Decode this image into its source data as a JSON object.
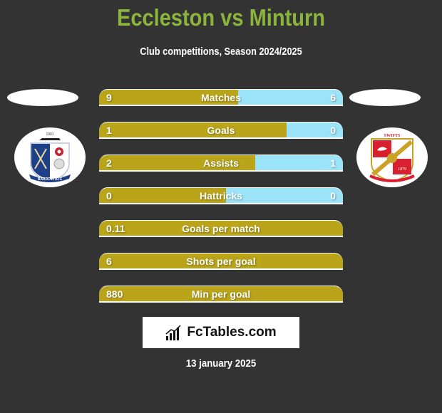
{
  "header": {
    "title": "Eccleston vs Minturn",
    "subtitle": "Club competitions, Season 2024/2025"
  },
  "teams": {
    "home": {
      "name": "Eccleston",
      "logo_text": "BARROW AFC",
      "logo_year": "1901"
    },
    "away": {
      "name": "Minturn",
      "logo_text": "SWIFTS",
      "logo_year": "1879"
    }
  },
  "colors": {
    "home_bar": "#b9a41a",
    "away_bar": "#9be3f7",
    "title": "#8ab43c",
    "background": "#333333"
  },
  "stats": [
    {
      "label": "Matches",
      "left": "9",
      "right": "6",
      "home_share": 0.57
    },
    {
      "label": "Goals",
      "left": "1",
      "right": "0",
      "home_share": 0.77
    },
    {
      "label": "Assists",
      "left": "2",
      "right": "1",
      "home_share": 0.64
    },
    {
      "label": "Hattricks",
      "left": "0",
      "right": "0",
      "home_share": 0.52
    },
    {
      "label": "Goals per match",
      "left": "0.11",
      "right": "",
      "home_share": 1
    },
    {
      "label": "Shots per goal",
      "left": "6",
      "right": "",
      "home_share": 1
    },
    {
      "label": "Min per goal",
      "left": "880",
      "right": "",
      "home_share": 1
    }
  ],
  "brand": {
    "name": "FcTables.com",
    "icon": "bar-chart-icon"
  },
  "footer": {
    "date": "13 january 2025"
  }
}
